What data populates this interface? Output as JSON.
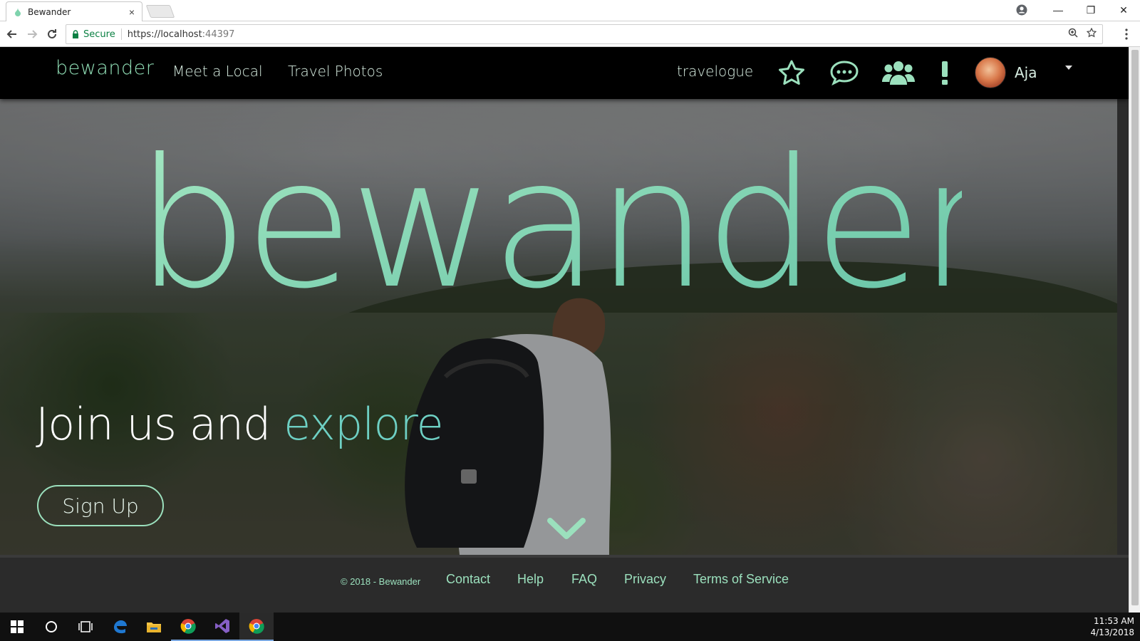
{
  "browser": {
    "tab_title": "Bewander",
    "tab_close": "×",
    "secure_label": "Secure",
    "url_scheme": "https://",
    "url_host": "localhost",
    "url_port": ":44397",
    "win_minimize": "—",
    "win_restore": "❐",
    "win_close": "✕"
  },
  "navbar": {
    "brand": "bewander",
    "links": [
      "Meet a Local",
      "Travel Photos"
    ],
    "travelogue": "travelogue",
    "user_name": "Aja",
    "accent_color": "#8fdcb4"
  },
  "hero": {
    "logo_text": "bewander",
    "headline_main": "Join us and ",
    "headline_accent": "explore",
    "signup_label": "Sign Up",
    "accent_color": "#6ed0c4"
  },
  "footer": {
    "copyright": "© 2018 - Bewander",
    "links": [
      "Contact",
      "Help",
      "FAQ",
      "Privacy",
      "Terms of Service"
    ]
  },
  "taskbar": {
    "time": "11:53 AM",
    "date": "4/13/2018"
  }
}
